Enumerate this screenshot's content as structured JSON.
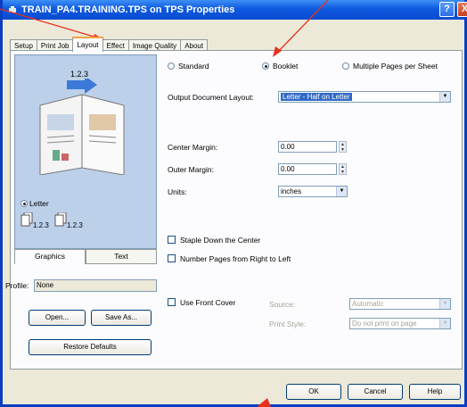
{
  "window": {
    "title": "TRAIN_PA4.TRAINING.TPS on TPS Properties",
    "help_label": "?",
    "close_label": "X"
  },
  "tabs": [
    "Setup",
    "Print Job",
    "Layout",
    "Effect",
    "Image Quality",
    "About"
  ],
  "active_tab": "Layout",
  "preview": {
    "pages_label": "1.2.3",
    "paper_label": "Letter",
    "copy1": "1.2.3",
    "copy2": "1.2.3"
  },
  "left": {
    "subtabs": [
      "Graphics",
      "Text"
    ],
    "profile_label": "Profile:",
    "profile_value": "None",
    "open_label": "Open...",
    "save_as_label": "Save As...",
    "restore_label": "Restore Defaults"
  },
  "layout_options": {
    "standard": "Standard",
    "booklet": "Booklet",
    "multi": "Multiple Pages per Sheet",
    "selected": "Booklet"
  },
  "output_layout": {
    "label": "Output Document Layout:",
    "value": "Letter - Half on Letter"
  },
  "center_margin": {
    "label": "Center Margin:",
    "value": "0.00"
  },
  "outer_margin": {
    "label": "Outer Margin:",
    "value": "0.00"
  },
  "units": {
    "label": "Units:",
    "value": "inches"
  },
  "staple": {
    "label": "Staple Down the Center",
    "checked": false
  },
  "number_pages": {
    "label": "Number Pages from Right to Left",
    "checked": false
  },
  "front_cover": {
    "label": "Use Front Cover",
    "checked": false,
    "source_label": "Source:",
    "source_value": "Automatic",
    "print_style_label": "Print Style:",
    "print_style_value": "Do not print on page"
  },
  "footer": {
    "ok": "OK",
    "cancel": "Cancel",
    "help": "Help"
  },
  "colors": {
    "titlebar": "#0d5ae0",
    "annotation": "#e8321f",
    "selection": "#316ac5"
  }
}
